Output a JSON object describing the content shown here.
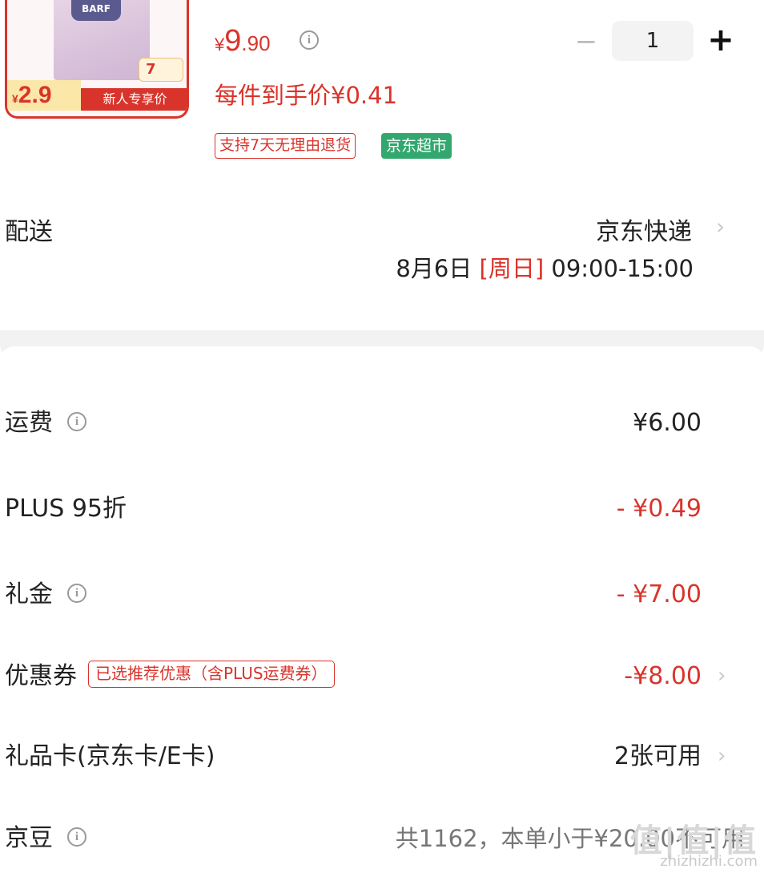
{
  "product": {
    "thumb_logo": "BARF",
    "thumb_tag": "7",
    "thumb_price_int": "2.9",
    "thumb_newuser_label": "新人专享价",
    "price_currency": "¥",
    "price_int": "9",
    "price_dec": ".90",
    "unit_price": "每件到手价¥0.41",
    "quantity": "1",
    "minus_label": "−",
    "plus_label": "+",
    "tag_return": "支持7天无理由退货",
    "tag_store": "京东超市",
    "accent_color": "#d9342b",
    "store_tag_color": "#32a86e"
  },
  "delivery": {
    "label": "配送",
    "method": "京东快递",
    "date": "8月6日 ",
    "day": "[周日]",
    "time": " 09:00-15:00"
  },
  "fees": {
    "shipping": {
      "label": "运费",
      "value": "¥6.00"
    },
    "plus_discount": {
      "label": "PLUS 95折",
      "value": "- ¥0.49"
    },
    "gift_money": {
      "label": "礼金",
      "value": "- ¥7.00"
    },
    "coupon": {
      "label": "优惠券",
      "tag": "已选推荐优惠（含PLUS运费券）",
      "value": "-¥8.00"
    },
    "gift_card": {
      "label": "礼品卡(京东卡/E卡)",
      "value": "2张可用"
    },
    "beans": {
      "label": "京豆",
      "note": "共1162，本单小于¥20.00不可用"
    }
  },
  "icons": {
    "info": "info-icon",
    "chevron": "chevron-right-icon"
  },
  "watermark": {
    "logo": "值|值|值",
    "site": "zhizhizhi.com"
  }
}
